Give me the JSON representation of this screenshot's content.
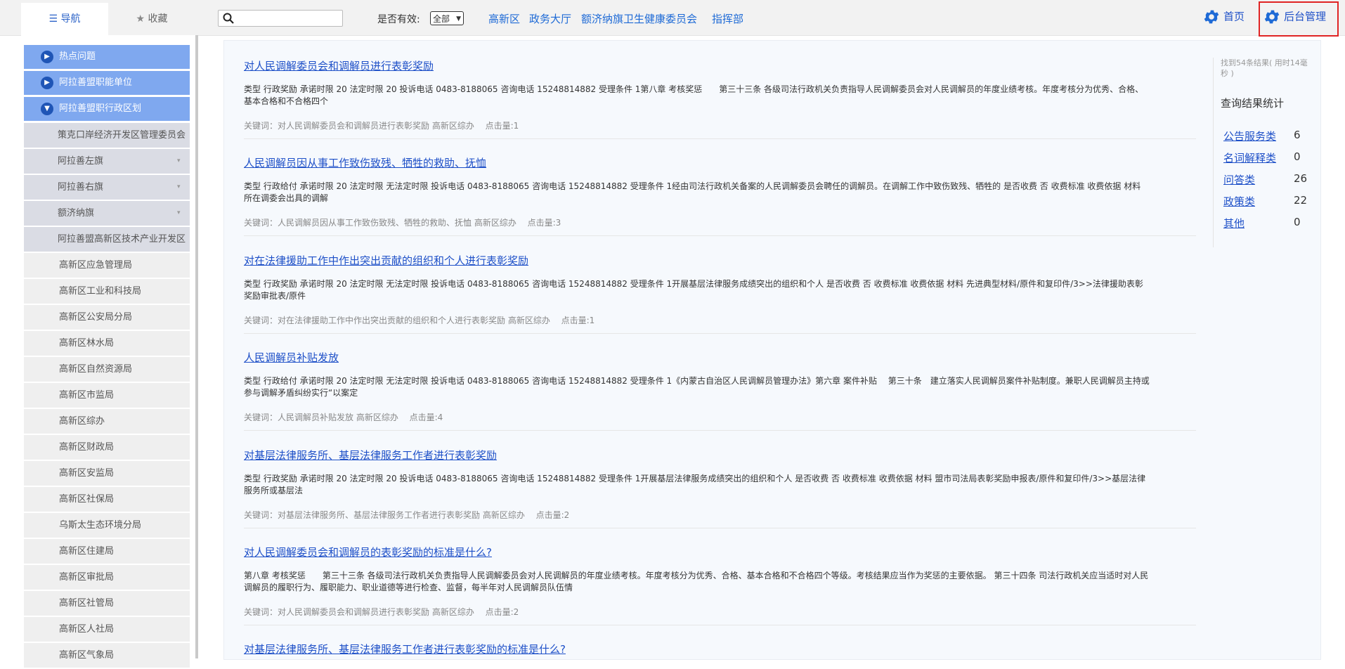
{
  "header": {
    "tab_nav": "导航",
    "tab_fav": "收藏",
    "search_placeholder": "",
    "valid_label": "是否有效:",
    "valid_value": "全部",
    "quick_links": [
      "高新区",
      "政务大厅",
      "额济纳旗卫生健康委员会",
      "指挥部"
    ],
    "home": "首页",
    "admin": "后台管理",
    "accent_color": "#1e6ad6",
    "highlight_color": "#e02424"
  },
  "sidebar": {
    "top_items": [
      "热点问题",
      "阿拉善盟职能单位",
      "阿拉善盟职行政区划"
    ],
    "sub_items": [
      "策克口岸经济开发区管理委员会",
      "阿拉善左旗",
      "阿拉善右旗",
      "额济纳旗",
      "阿拉善盟高新区技术产业开发区"
    ],
    "leaf_items": [
      "高新区应急管理局",
      "高新区工业和科技局",
      "高新区公安局分局",
      "高新区林水局",
      "高新区自然资源局",
      "高新区市监局",
      "高新区综办",
      "高新区财政局",
      "高新区安监局",
      "高新区社保局",
      "乌斯太生态环境分局",
      "高新区住建局",
      "高新区审批局",
      "高新区社管局",
      "高新区人社局",
      "高新区气象局"
    ]
  },
  "results": [
    {
      "title": "对人民调解委员会和调解员进行表彰奖励",
      "desc": "类型 行政奖励 承诺时限 20 法定时限 20 投诉电话 0483-8188065 咨询电话 15248814882 受理条件 1第八章 考核奖惩　　第三十三条 各级司法行政机关负责指导人民调解委员会对人民调解员的年度业绩考核。年度考核分为优秀、合格、基本合格和不合格四个",
      "keywords": "关键词：对人民调解委员会和调解员进行表彰奖励 高新区综办　 点击量:1"
    },
    {
      "title": "人民调解员因从事工作致伤致残、牺牲的救助、抚恤",
      "desc": "类型 行政给付 承诺时限 20 法定时限 无法定时限 投诉电话 0483-8188065 咨询电话 15248814882 受理条件 1经由司法行政机关备案的人民调解委员会聘任的调解员。在调解工作中致伤致残、牺牲的 是否收费 否 收费标准 收费依据 材料 所在调委会出具的调解",
      "keywords": "关键词：人民调解员因从事工作致伤致残、牺牲的救助、抚恤 高新区综办　 点击量:3"
    },
    {
      "title": "对在法律援助工作中作出突出贡献的组织和个人进行表彰奖励",
      "desc": "类型 行政奖励 承诺时限 20 法定时限 无法定时限 投诉电话 0483-8188065 咨询电话 15248814882 受理条件 1开展基层法律服务成绩突出的组织和个人 是否收费 否 收费标准 收费依据 材料 先进典型材料/原件和复印件/3>>法律援助表彰奖励审批表/原件",
      "keywords": "关键词：对在法律援助工作中作出突出贡献的组织和个人进行表彰奖励 高新区综办　 点击量:1"
    },
    {
      "title": "人民调解员补贴发放",
      "desc": "类型 行政给付 承诺时限 20 法定时限 无法定时限 投诉电话 0483-8188065 咨询电话 15248814882 受理条件 1《内蒙古自治区人民调解员管理办法》第六章 案件补贴　 第三十条　建立落实人民调解员案件补贴制度。兼职人民调解员主持或参与调解矛盾纠纷实行“以案定",
      "keywords": "关键词：人民调解员补贴发放 高新区综办　 点击量:4"
    },
    {
      "title": "对基层法律服务所、基层法律服务工作者进行表彰奖励",
      "desc": "类型 行政奖励 承诺时限 20 法定时限 20 投诉电话 0483-8188065 咨询电话 15248814882 受理条件 1开展基层法律服务成绩突出的组织和个人 是否收费 否 收费标准 收费依据 材料 盟市司法局表彰奖励申报表/原件和复印件/3>>基层法律服务所或基层法",
      "keywords": "关键词：对基层法律服务所、基层法律服务工作者进行表彰奖励 高新区综办　 点击量:2"
    },
    {
      "title": "对人民调解委员会和调解员的表彰奖励的标准是什么?",
      "desc": "第八章 考核奖惩　　第三十三条 各级司法行政机关负责指导人民调解委员会对人民调解员的年度业绩考核。年度考核分为优秀、合格、基本合格和不合格四个等级。考核结果应当作为奖惩的主要依据。 第三十四条 司法行政机关应当适时对人民调解员的履职行为、履职能力、职业道德等进行检查、监督，每半年对人民调解员队伍情",
      "keywords": "关键词：对人民调解委员会和调解员进行表彰奖励 高新区综办　 点击量:2"
    },
    {
      "title": "对基层法律服务所、基层法律服务工作者进行表彰奖励的标准是什么?",
      "desc": "",
      "keywords": ""
    }
  ],
  "stats": {
    "found": "找到54条结果( 用时14毫秒 )",
    "title": "查询结果统计",
    "rows": [
      {
        "label": "公告服务类",
        "value": "6"
      },
      {
        "label": "名词解释类",
        "value": "0"
      },
      {
        "label": "问答类",
        "value": "26"
      },
      {
        "label": "政策类",
        "value": "22"
      },
      {
        "label": "其他",
        "value": "0"
      }
    ]
  }
}
